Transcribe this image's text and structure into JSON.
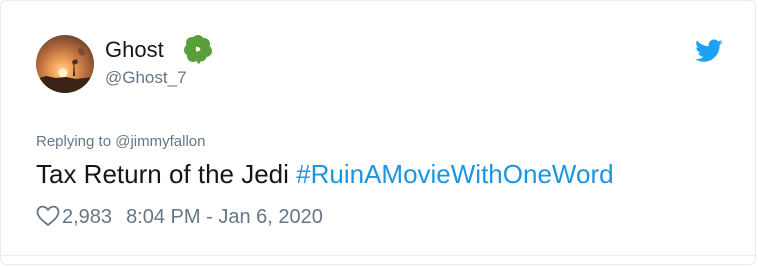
{
  "user": {
    "display_name": "Ghost",
    "handle": "@Ghost_7"
  },
  "tweet": {
    "reply_prefix": "Replying to ",
    "reply_to": "@jimmyfallon",
    "text": "Tax Return of the Jedi ",
    "hashtag": "#RuinAMovieWithOneWord",
    "likes": "2,983",
    "timestamp": "8:04 PM - Jan 6, 2020"
  },
  "icons": {
    "avatar": "sunset-avatar",
    "name_emoji": "four-leaf-clover-icon",
    "brand": "twitter-bird-icon",
    "like": "heart-icon"
  },
  "colors": {
    "hashtag": "#1b95e0",
    "twitter_blue": "#1da1f2",
    "clover": "#5a9e3a",
    "muted": "#657786"
  }
}
